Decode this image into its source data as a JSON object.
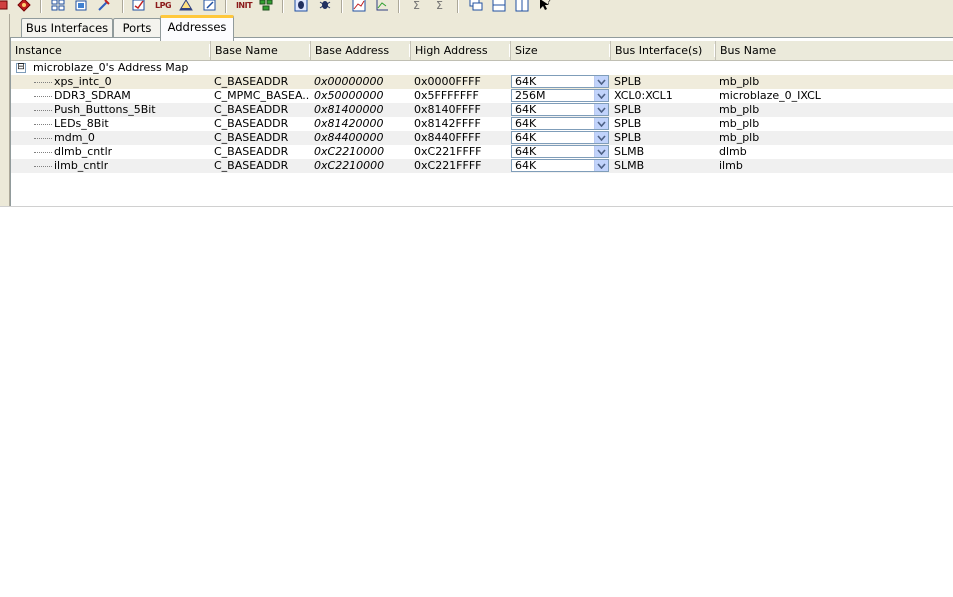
{
  "toolbar": {
    "icons": [
      "chip-icon",
      "seal-icon",
      "bus-icon",
      "brush-icon",
      "generate-icon",
      "lpg-text-icon",
      "build-icon",
      "netlist-icon",
      "init-text-icon",
      "network-icon",
      "bug-icon",
      "debug-icon",
      "chart-icon",
      "graph-icon",
      "sigma-icon",
      "sigma2-icon",
      "window-icon",
      "split-icon",
      "tile-icon",
      "help-pointer-icon"
    ],
    "lpg_label": "LPG",
    "init_label": "INIT"
  },
  "tabs": [
    {
      "label": "Bus Interfaces"
    },
    {
      "label": "Ports"
    },
    {
      "label": "Addresses"
    }
  ],
  "columns": [
    "Instance",
    "Base Name",
    "Base Address",
    "High Address",
    "Size",
    "Bus Interface(s)",
    "Bus Name"
  ],
  "tree_root": {
    "label": "microblaze_0's Address Map",
    "expander": "⊟"
  },
  "rows": [
    {
      "instance": "xps_intc_0",
      "base_name": "C_BASEADDR",
      "base_address": "0x00000000",
      "high_address": "0x0000FFFF",
      "size": "64K",
      "bus_interface": "SPLB",
      "bus_name": "mb_plb"
    },
    {
      "instance": "DDR3_SDRAM",
      "base_name": "C_MPMC_BASEA...",
      "base_address": "0x50000000",
      "high_address": "0x5FFFFFFF",
      "size": "256M",
      "bus_interface": "XCL0:XCL1",
      "bus_name": "microblaze_0_IXCL"
    },
    {
      "instance": "Push_Buttons_5Bit",
      "base_name": "C_BASEADDR",
      "base_address": "0x81400000",
      "high_address": "0x8140FFFF",
      "size": "64K",
      "bus_interface": "SPLB",
      "bus_name": "mb_plb"
    },
    {
      "instance": "LEDs_8Bit",
      "base_name": "C_BASEADDR",
      "base_address": "0x81420000",
      "high_address": "0x8142FFFF",
      "size": "64K",
      "bus_interface": "SPLB",
      "bus_name": "mb_plb"
    },
    {
      "instance": "mdm_0",
      "base_name": "C_BASEADDR",
      "base_address": "0x84400000",
      "high_address": "0x8440FFFF",
      "size": "64K",
      "bus_interface": "SPLB",
      "bus_name": "mb_plb"
    },
    {
      "instance": "dlmb_cntlr",
      "base_name": "C_BASEADDR",
      "base_address": "0xC2210000",
      "high_address": "0xC221FFFF",
      "size": "64K",
      "bus_interface": "SLMB",
      "bus_name": "dlmb"
    },
    {
      "instance": "ilmb_cntlr",
      "base_name": "C_BASEADDR",
      "base_address": "0xC2210000",
      "high_address": "0xC221FFFF",
      "size": "64K",
      "bus_interface": "SLMB",
      "bus_name": "ilmb"
    }
  ],
  "colors": {
    "tab_accent": "#ffc83c",
    "header_bg": "#ebeadb",
    "toolbar_bg": "#ece9d8",
    "dropdown_bg": "#c1d3fb"
  }
}
